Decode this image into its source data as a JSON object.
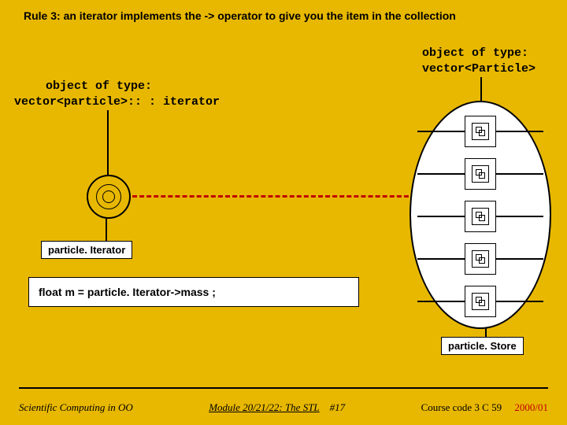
{
  "title": "Rule 3:  an iterator implements the  -> operator to give you the item in the collection",
  "labels": {
    "iterator_type_l1": "object of type:",
    "iterator_type_l2": "vector<particle>:: : iterator",
    "vector_type_l1": "object of type:",
    "vector_type_l2": "vector<Particle>",
    "particle_iterator": "particle. Iterator",
    "particle_store": "particle. Store"
  },
  "code": "float m = particle. Iterator->mass ;",
  "footer": {
    "left": "Scientific Computing in OO",
    "mid": "Module 20/21/22: The STL",
    "num": "#17",
    "course": "Course code 3 C 59",
    "year": "2000/01"
  }
}
